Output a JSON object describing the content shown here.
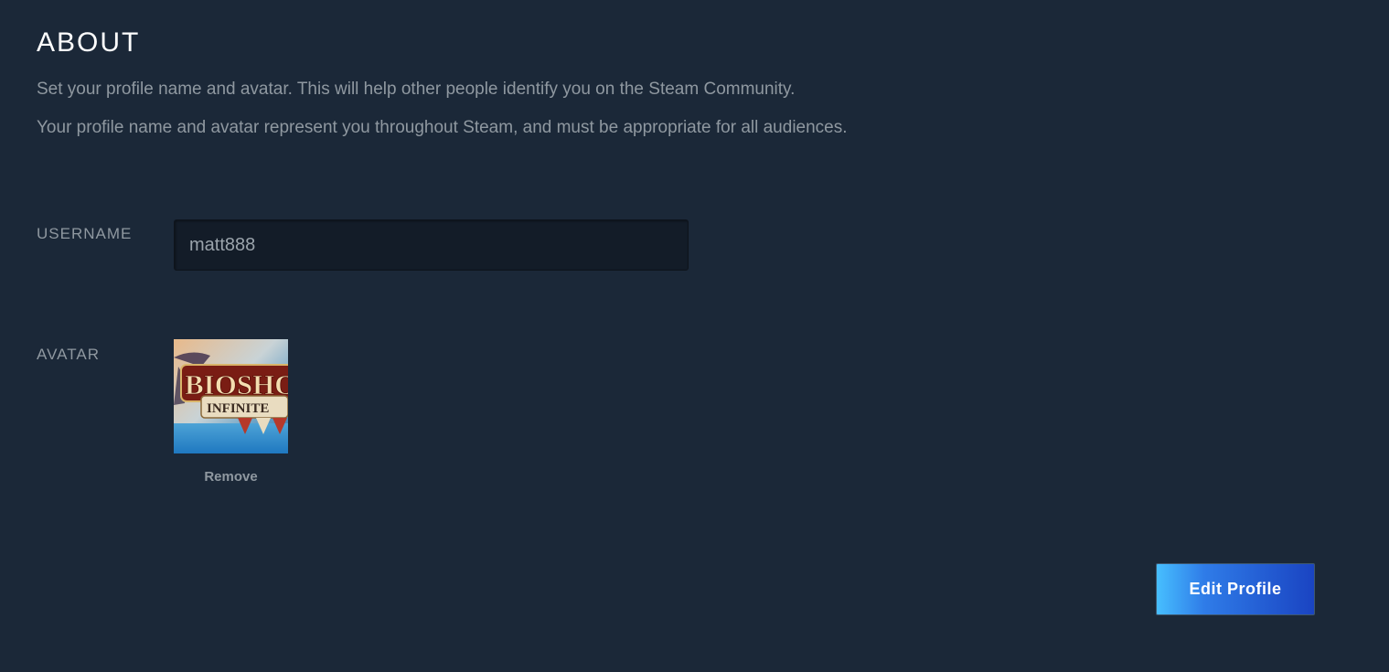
{
  "section": {
    "title": "ABOUT",
    "description_1": "Set your profile name and avatar. This will help other people identify you on the Steam Community.",
    "description_2": "Your profile name and avatar represent you throughout Steam, and must be appropriate for all audiences."
  },
  "username": {
    "label": "USERNAME",
    "value": "matt888"
  },
  "avatar": {
    "label": "AVATAR",
    "image_text_1": "BIOSHOCK",
    "image_text_2": "INFINITE",
    "remove_label": "Remove"
  },
  "actions": {
    "edit_profile_label": "Edit Profile"
  },
  "colors": {
    "background": "#1b2838",
    "muted_text": "#8f98a0",
    "accent_start": "#47bfff",
    "accent_end": "#1a44c2"
  }
}
